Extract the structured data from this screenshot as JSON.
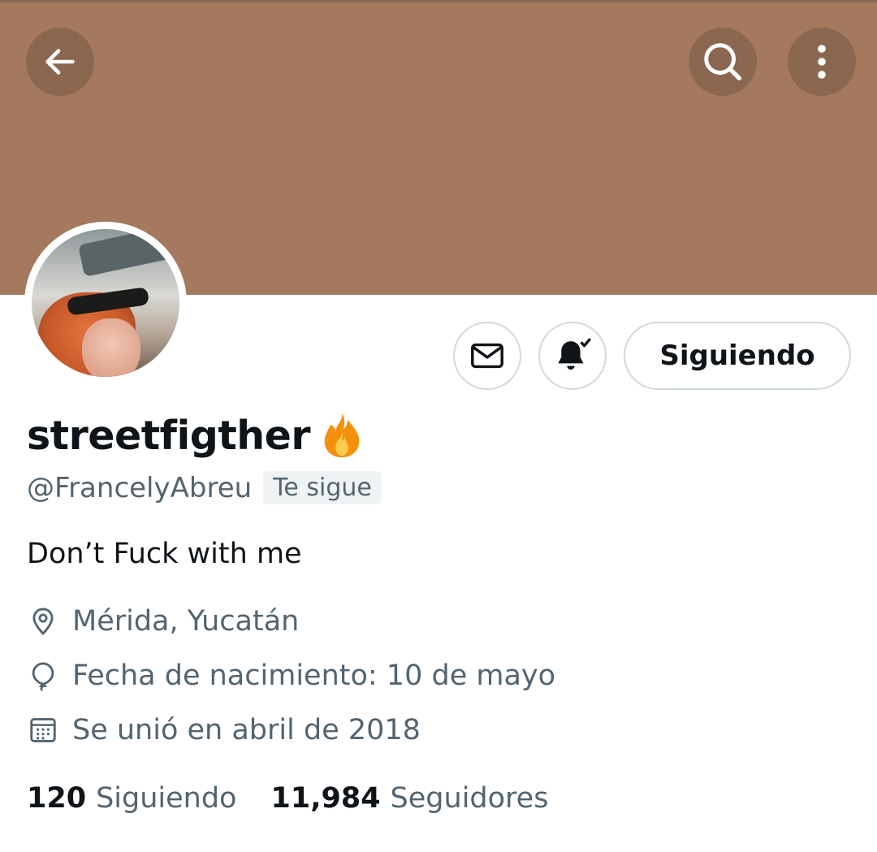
{
  "header": {
    "back_icon": "arrow-left-icon",
    "search_icon": "search-icon",
    "more_icon": "more-vertical-icon",
    "banner_color": "#a4795e"
  },
  "profile": {
    "display_name": "streetfigther",
    "name_emoji": "fire-icon",
    "handle": "@FrancelyAbreu",
    "follows_you_badge": "Te sigue",
    "bio": "Don’t Fuck with me",
    "location": "Mérida, Yucatán",
    "birthday": "Fecha de nacimiento: 10 de mayo",
    "joined": "Se unió en abril de 2018"
  },
  "actions": {
    "message_icon": "envelope-icon",
    "notifications_icon": "bell-check-icon",
    "follow_label": "Siguiendo"
  },
  "stats": {
    "following_count": "120",
    "following_label": "Siguiendo",
    "followers_count": "11,984",
    "followers_label": "Seguidores"
  },
  "colors": {
    "primary_text": "#0f1419",
    "secondary_text": "#536471",
    "border": "#cfd9de"
  }
}
